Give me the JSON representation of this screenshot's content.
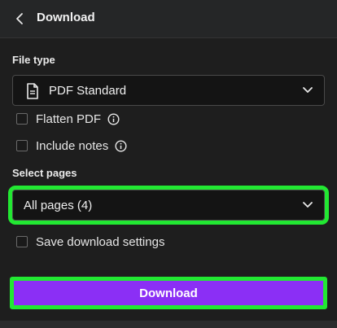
{
  "header": {
    "title": "Download",
    "back_icon": "chevron-left-icon"
  },
  "file_type": {
    "label": "File type",
    "selected": "PDF Standard",
    "icon": "document-icon",
    "options": [
      {
        "label": "Flatten PDF",
        "checked": false,
        "info": true
      },
      {
        "label": "Include notes",
        "checked": false,
        "info": true
      }
    ]
  },
  "select_pages": {
    "label": "Select pages",
    "selected": "All pages (4)"
  },
  "save_settings": {
    "label": "Save download settings",
    "checked": false
  },
  "download_button": {
    "label": "Download"
  },
  "colors": {
    "accent": "#8b2ff5",
    "highlight": "#22e832",
    "background": "#1e1e1e"
  }
}
